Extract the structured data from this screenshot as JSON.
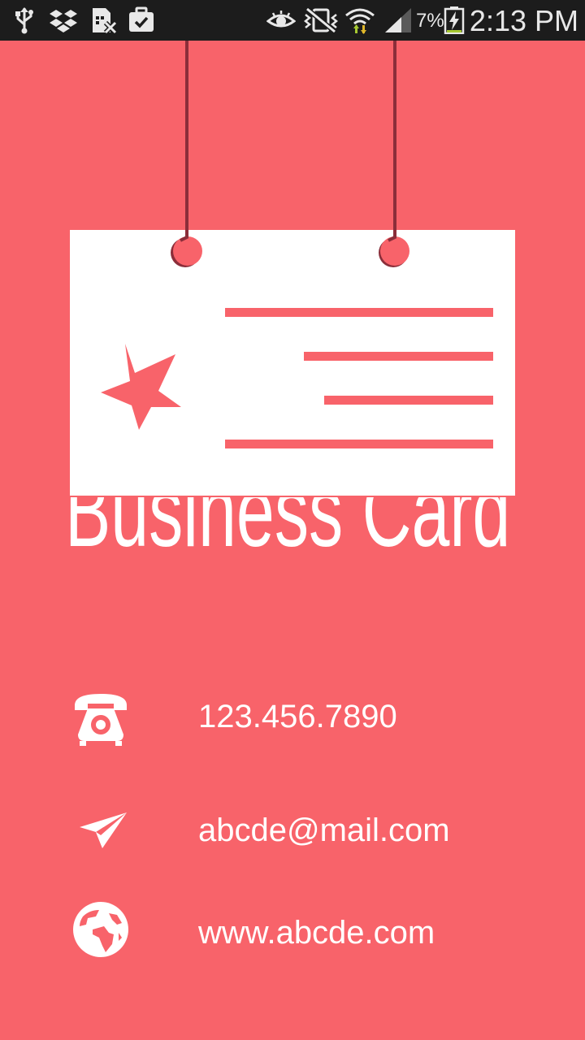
{
  "status_bar": {
    "battery_percent": "7%",
    "time": "2:13 PM",
    "icons": [
      "usb-icon",
      "dropbox-icon",
      "sim-missing-icon",
      "briefcase-check-icon",
      "eye-icon",
      "vibrate-silent-icon",
      "wifi-icon",
      "signal-icon",
      "battery-charging-icon"
    ]
  },
  "header": {
    "title": "Business Card"
  },
  "contact": {
    "phone": "123.456.7890",
    "email": "abcde@mail.com",
    "website": "www.abcde.com"
  },
  "colors": {
    "background": "#f8636a",
    "card": "#ffffff",
    "string": "#8b2e3a",
    "status_bar": "#1c1c1c"
  }
}
